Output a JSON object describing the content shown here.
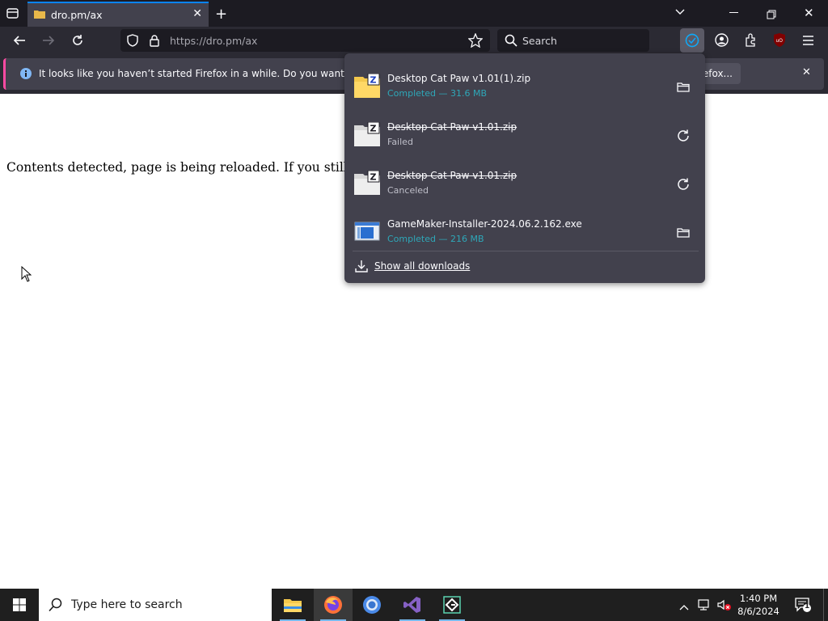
{
  "browser": {
    "tab": {
      "title": "dro.pm/ax"
    },
    "url": "https://dro.pm/ax",
    "search_placeholder": "Search"
  },
  "notification": {
    "message": "It looks like you haven’t started Firefox in a while. Do you want to clean it",
    "button_label": "efox..."
  },
  "page": {
    "text": "Contents detected, page is being reloaded. If you still see this"
  },
  "downloads": {
    "items": [
      {
        "name": "Desktop Cat Paw v1.01(1).zip",
        "status": "Completed — 31.6 MB",
        "state": "completed",
        "icon": "zip-file-icon",
        "action": "open-folder-icon"
      },
      {
        "name": "Desktop Cat Paw v1.01.zip",
        "status": "Failed",
        "state": "failed",
        "icon": "zip-file-icon",
        "action": "retry-icon"
      },
      {
        "name": "Desktop Cat Paw v1.01.zip",
        "status": "Canceled",
        "state": "canceled",
        "icon": "zip-file-icon",
        "action": "retry-icon"
      },
      {
        "name": "GameMaker-Installer-2024.06.2.162.exe",
        "status": "Completed — 216 MB",
        "state": "completed",
        "icon": "exe-file-icon",
        "action": "open-folder-icon"
      }
    ],
    "show_all_label": "Show all downloads"
  },
  "taskbar": {
    "search_placeholder": "Type here to search",
    "apps": [
      "file-explorer-icon",
      "firefox-icon",
      "chrome-icon",
      "visual-studio-icon",
      "gamemaker-icon"
    ],
    "time": "1:40 PM",
    "date": "8/6/2024",
    "notification_count": "1"
  },
  "colors": {
    "accent": "#0a84ff",
    "completed_status": "#2ea7b8",
    "notif_strip": "#ff4aa2"
  }
}
